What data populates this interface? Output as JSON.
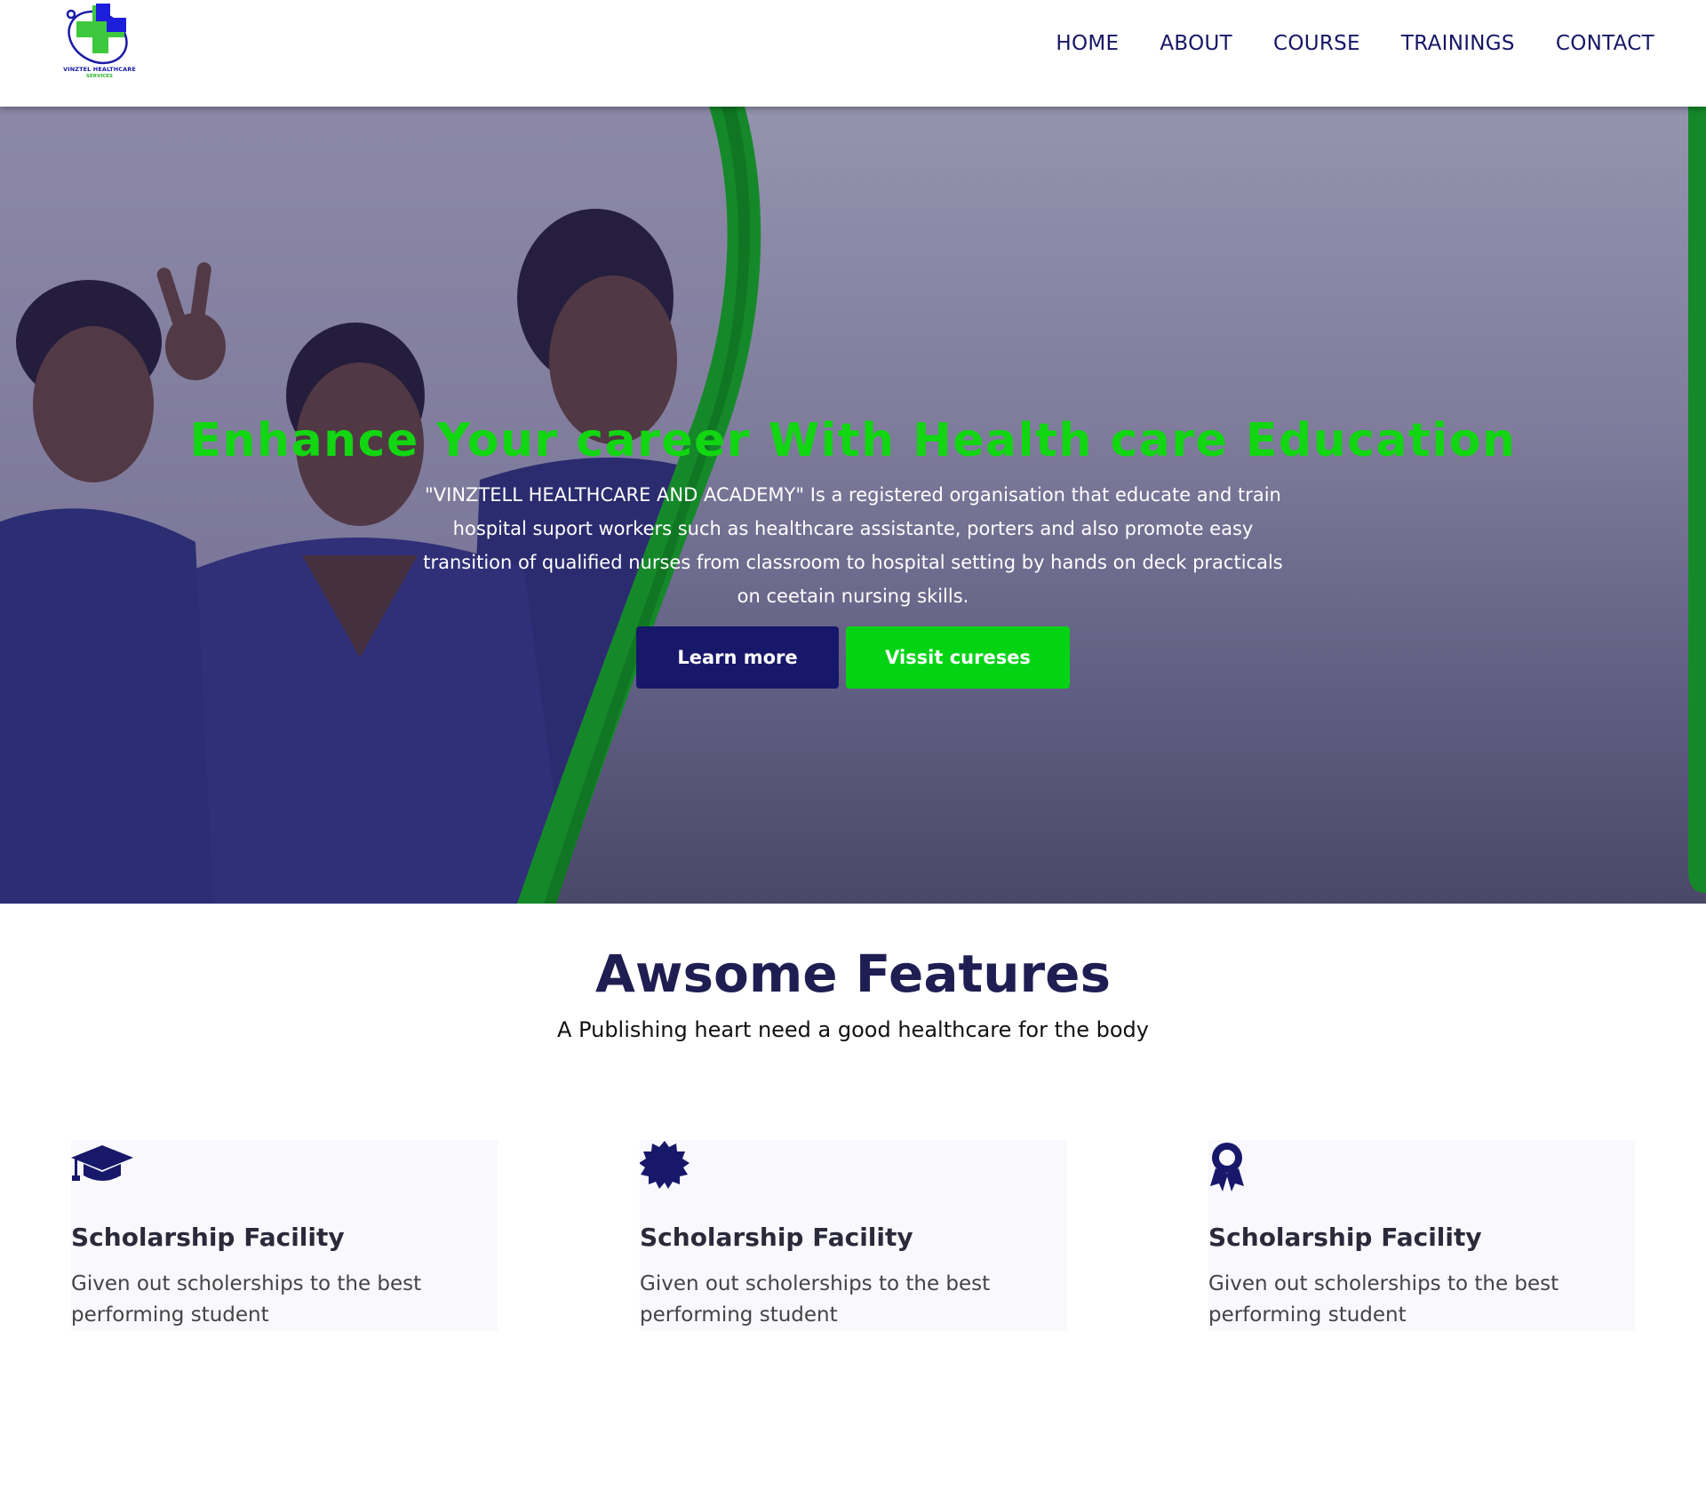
{
  "header": {
    "logo": {
      "name": "VINZTEL HEALTHCARE",
      "tagline": "SERVICES",
      "icon": "medical-cross-stethoscope-logo"
    },
    "nav": [
      "HOME",
      "ABOUT",
      "COURSE",
      "TRAININGS",
      "CONTACT"
    ]
  },
  "hero": {
    "title": "Enhance Your career With Health care Education",
    "description": "\"VINZTELL HEALTHCARE AND ACADEMY\" Is a registered organisation that educate and train hospital suport workers such as healthcare assistante, porters and also promote easy transition of qualified nurses from classroom to hospital setting by hands on deck practicals on ceetain nursing skills.",
    "learn_more": "Learn more",
    "visit_courses": "Vissit cureses"
  },
  "features": {
    "title": "Awsome Features",
    "subtitle": "A Publishing heart need a good healthcare for the body",
    "cards": [
      {
        "icon": "graduation-cap-icon",
        "title": "Scholarship Facility",
        "text": "Given out scholerships to the best performing student"
      },
      {
        "icon": "starburst-badge-icon",
        "title": "Scholarship Facility",
        "text": "Given out scholerships to the best performing student"
      },
      {
        "icon": "award-ribbon-icon",
        "title": "Scholarship Facility",
        "text": "Given out scholerships to the best performing student"
      }
    ]
  },
  "colors": {
    "navy": "#17186a",
    "green": "#04d314",
    "hero_title_green": "#11d611",
    "hero_overlay": "#7f7c9c"
  }
}
